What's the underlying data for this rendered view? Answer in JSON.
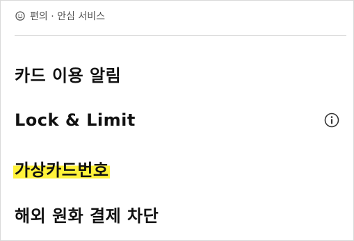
{
  "section": {
    "title": "편의 · 안심 서비스",
    "icon": "smile-icon"
  },
  "menu": {
    "items": [
      {
        "label": "카드 이용 알림"
      },
      {
        "label": "Lock & Limit",
        "icon": "info-icon"
      },
      {
        "label": "가상카드번호",
        "highlighted": true,
        "highlight_color": "#fff23a"
      },
      {
        "label": "해외 원화 결제 차단"
      }
    ]
  }
}
